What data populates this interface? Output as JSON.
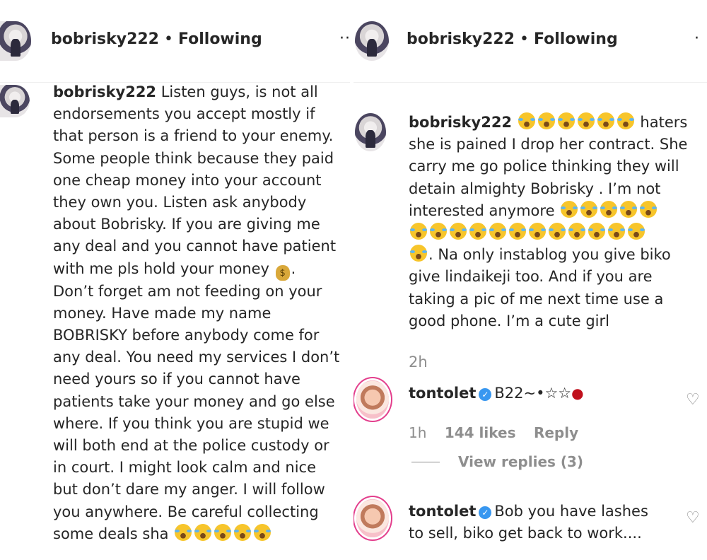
{
  "left": {
    "header": {
      "username": "bobrisky222",
      "separator": "•",
      "follow_status": "Following"
    },
    "comment": {
      "username": "bobrisky222",
      "lines": [
        " Listen guys, is not all",
        "endorsements you accept mostly if",
        "that person is a friend to your enemy.",
        "Some people think because they paid",
        "one cheap money into your account",
        "they own you. Listen ask anybody",
        "about Bobrisky. If you are giving me",
        "any deal and you cannot have patient",
        "with me pls hold your money",
        "Don’t forget am not feeding on your",
        "money. Have made my name",
        "BOBRISKY before anybody come for",
        "any deal. You need my services I don’t",
        "need yours so if you cannot have",
        "patients take your money and go else",
        "where. If you think you are stupid we",
        "will both end at the police custody or",
        "in court. I might look calm and nice",
        "but don’t dare my anger. I will follow",
        "you anywhere. Be careful collecting",
        "some deals sha"
      ],
      "money_bag_emoji": "💰",
      "trailing_emoji": "😂"
    }
  },
  "right": {
    "header": {
      "username": "bobrisky222",
      "separator": "•",
      "follow_status": "Following"
    },
    "post": {
      "username": "bobrisky222",
      "line1_after_emojis": " haters",
      "lines": [
        "she is pained I drop her contract. She",
        "carry me go police thinking they will",
        "detain almighty Bobrisky . I’m not"
      ],
      "line5_prefix": "interested anymore ",
      "line7_suffix": ". Na only instablog you give biko",
      "lines_tail": [
        "give lindaikeji too. And if you are",
        "taking a pic of me next time use a",
        "good phone. I’m a cute girl"
      ],
      "time": "2h"
    },
    "reply1": {
      "username": "tontolet",
      "text": "B22~•☆☆",
      "lips_emoji": "💋",
      "time": "1h",
      "likes": "144 likes",
      "reply_label": "Reply",
      "view_replies": "View replies (3)"
    },
    "reply2": {
      "username": "tontolet",
      "text_line1": "Bob you have lashes",
      "text_line2": "to sell, biko get back to work...."
    },
    "icons": {
      "heart": "♡",
      "verified": "✓"
    }
  }
}
